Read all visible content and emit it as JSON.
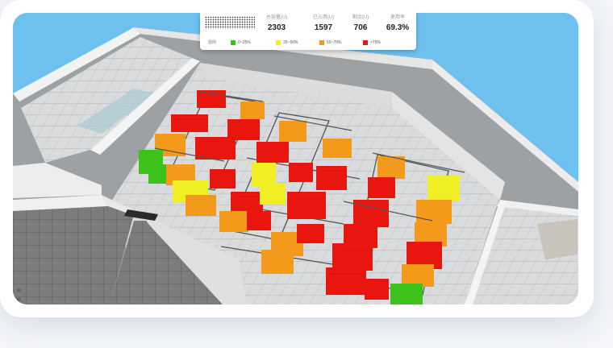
{
  "stats": {
    "items": [
      {
        "label": "总容量(U)",
        "value": "2303"
      },
      {
        "label": "已占用(U)",
        "value": "1597"
      },
      {
        "label": "剩余(U)",
        "value": "706"
      },
      {
        "label": "使用率",
        "value": "69.3%"
      }
    ]
  },
  "legend": {
    "title": "图例",
    "items": [
      {
        "label": "0~25%",
        "color": "#3ec11a"
      },
      {
        "label": "25~50%",
        "color": "#f0ee25"
      },
      {
        "label": "50~70%",
        "color": "#f39a1c"
      },
      {
        "label": ">70%",
        "color": "#e8160e"
      }
    ]
  },
  "colors": {
    "sky": "#6ec0ee",
    "low": "#3ec11a",
    "mid": "#f0ee25",
    "high": "#f39a1c",
    "full": "#e8160e"
  }
}
